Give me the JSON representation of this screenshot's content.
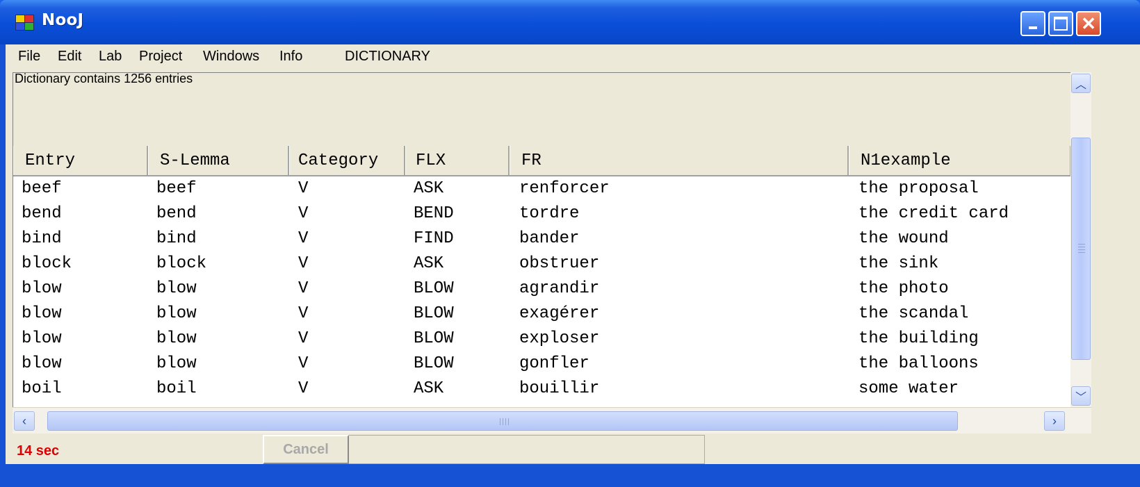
{
  "window": {
    "title": "NooJ"
  },
  "menu": [
    "File",
    "Edit",
    "Lab",
    "Project",
    "Windows",
    "Info",
    "DICTIONARY"
  ],
  "info": {
    "text": "Dictionary contains 1256 entries"
  },
  "table": {
    "columns": [
      "Entry",
      "S-Lemma",
      "Category",
      "FLX",
      "FR",
      "N1example"
    ],
    "rows": [
      [
        "beef",
        "beef",
        "V",
        "ASK",
        "renforcer",
        "the proposal"
      ],
      [
        "bend",
        "bend",
        "V",
        "BEND",
        "tordre",
        "the credit card"
      ],
      [
        "bind",
        "bind",
        "V",
        "FIND",
        "bander",
        "the wound"
      ],
      [
        "block",
        "block",
        "V",
        "ASK",
        "obstruer",
        "the sink"
      ],
      [
        "blow",
        "blow",
        "V",
        "BLOW",
        "agrandir",
        "the photo"
      ],
      [
        "blow",
        "blow",
        "V",
        "BLOW",
        "exagérer",
        "the scandal"
      ],
      [
        "blow",
        "blow",
        "V",
        "BLOW",
        "exploser",
        "the building"
      ],
      [
        "blow",
        "blow",
        "V",
        "BLOW",
        "gonfler",
        "the balloons"
      ],
      [
        "boil",
        "boil",
        "V",
        "ASK",
        "bouillir",
        "some water"
      ]
    ]
  },
  "status": {
    "time": "14 sec",
    "cancel_label": "Cancel"
  },
  "colors": {
    "titlebar": "#0a4ed8",
    "status_time": "#e00000",
    "window_bg": "#ece9d8"
  }
}
